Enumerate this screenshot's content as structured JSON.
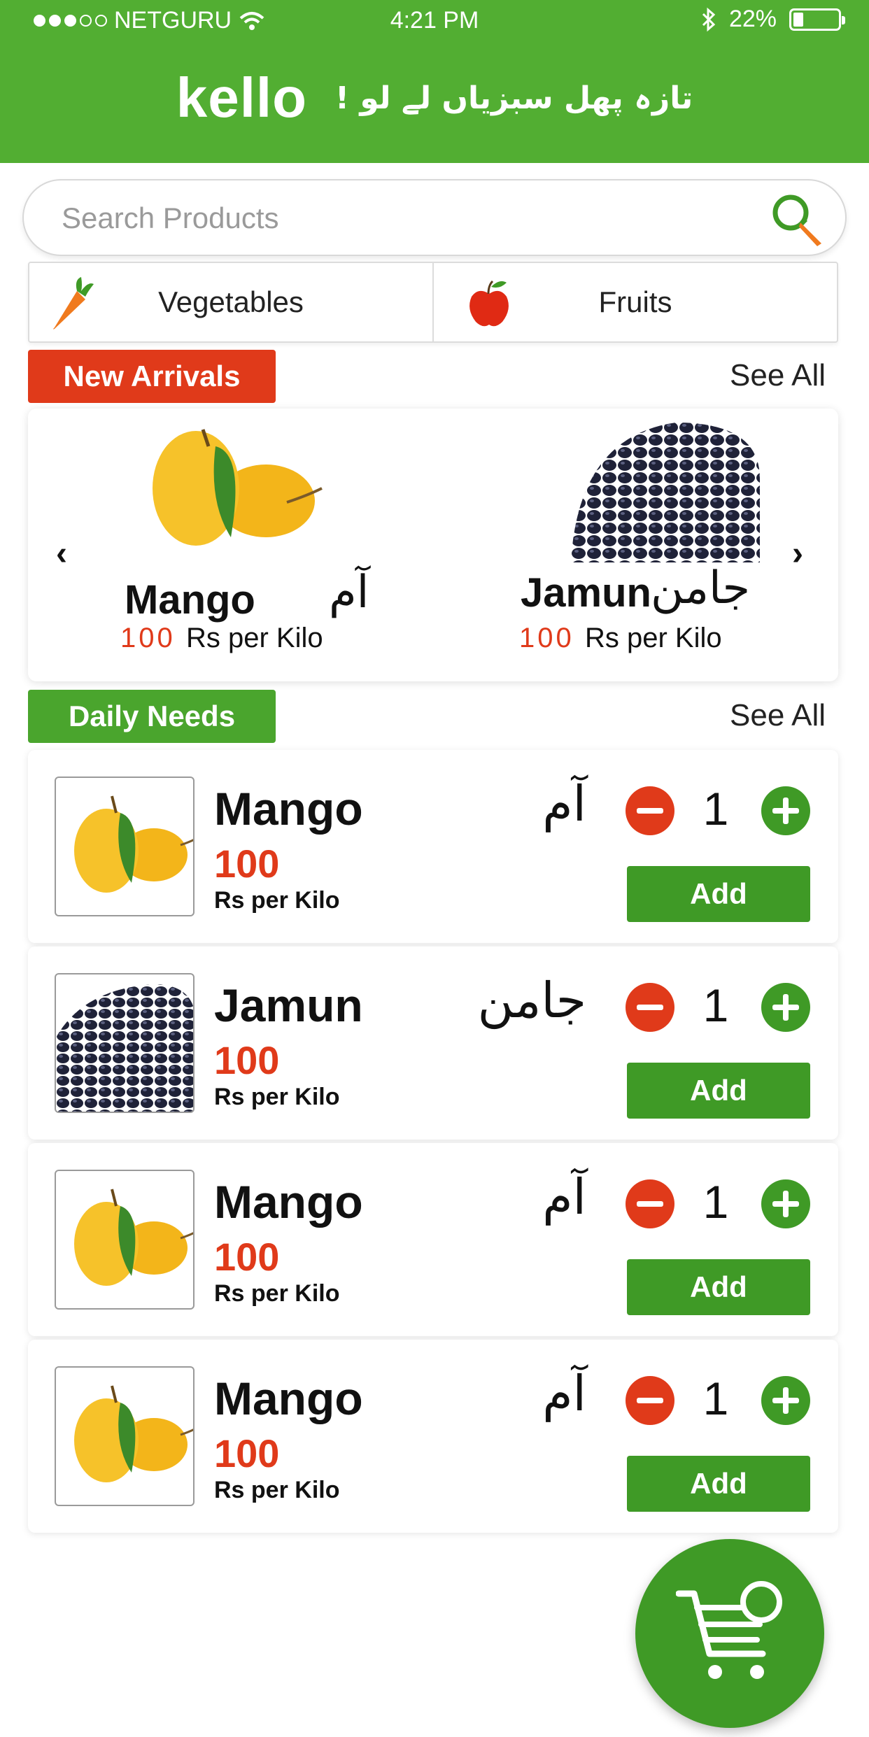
{
  "status_bar": {
    "carrier": "NETGURU",
    "time": "4:21 PM",
    "battery": "22%"
  },
  "header": {
    "logo": "kello",
    "tagline": "تازہ پھل سبزیاں لے لو !"
  },
  "search": {
    "placeholder": "Search Products",
    "icon": "search-carrot-icon"
  },
  "categories": [
    {
      "label": "Vegetables",
      "icon": "carrot-icon"
    },
    {
      "label": "Fruits",
      "icon": "apple-icon"
    }
  ],
  "new_arrivals": {
    "title": "New Arrivals",
    "see_all": "See All",
    "items": [
      {
        "name": "Mango",
        "urdu": "آم",
        "price": "100",
        "unit": "Rs per Kilo"
      },
      {
        "name": "Jamun",
        "urdu": "جامن",
        "price": "100",
        "unit": "Rs per Kilo"
      }
    ]
  },
  "daily_needs": {
    "title": "Daily Needs",
    "see_all": "See All",
    "items": [
      {
        "name": "Mango",
        "urdu": "آم",
        "price": "100",
        "unit": "Rs per Kilo",
        "qty": "1",
        "add": "Add"
      },
      {
        "name": "Jamun",
        "urdu": "جامن",
        "price": "100",
        "unit": "Rs per Kilo",
        "qty": "1",
        "add": "Add"
      },
      {
        "name": "Mango",
        "urdu": "آم",
        "price": "100",
        "unit": "Rs per Kilo",
        "qty": "1",
        "add": "Add"
      },
      {
        "name": "Mango",
        "urdu": "آم",
        "price": "100",
        "unit": "Rs per Kilo",
        "qty": "1",
        "add": "Add"
      }
    ]
  },
  "colors": {
    "brand_green": "#52ae32",
    "button_green": "#3f9a26",
    "accent_red": "#e03a1a"
  }
}
